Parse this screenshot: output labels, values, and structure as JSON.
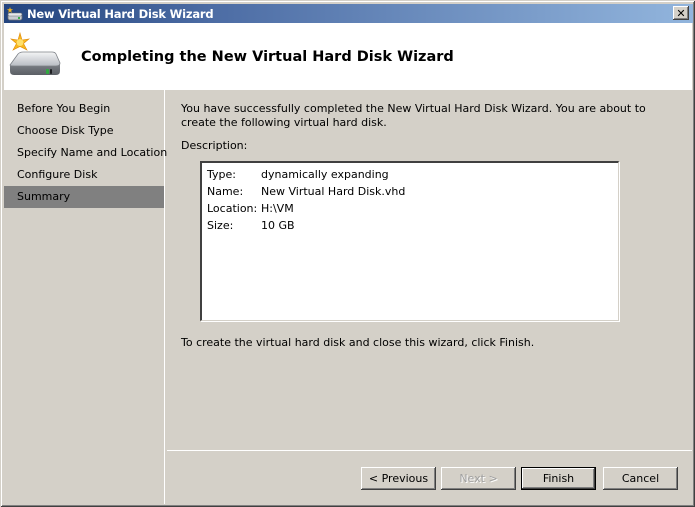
{
  "window": {
    "title": "New Virtual Hard Disk Wizard",
    "close_label": "✕"
  },
  "header": {
    "heading": "Completing the New Virtual Hard Disk Wizard",
    "icon": "hard-disk-new-icon"
  },
  "sidebar": {
    "items": [
      {
        "label": "Before You Begin",
        "active": false
      },
      {
        "label": "Choose Disk Type",
        "active": false
      },
      {
        "label": "Specify Name and Location",
        "active": false
      },
      {
        "label": "Configure Disk",
        "active": false
      },
      {
        "label": "Summary",
        "active": true
      }
    ]
  },
  "content": {
    "intro": "You have successfully completed the New Virtual Hard Disk Wizard. You are about to create the following virtual hard disk.",
    "description_label": "Description:",
    "description": [
      {
        "key": "Type:",
        "value": "dynamically expanding"
      },
      {
        "key": "Name:",
        "value": "New Virtual Hard Disk.vhd"
      },
      {
        "key": "Location:",
        "value": "H:\\VM"
      },
      {
        "key": "Size:",
        "value": "10 GB"
      }
    ],
    "finish_hint": "To create the virtual hard disk and close this wizard, click Finish."
  },
  "buttons": {
    "previous": "< Previous",
    "next": "Next >",
    "finish": "Finish",
    "cancel": "Cancel"
  }
}
